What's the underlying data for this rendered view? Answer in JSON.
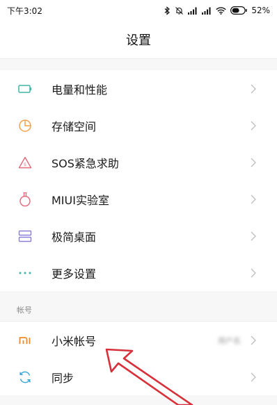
{
  "statusbar": {
    "time": "下午3:02",
    "battery_percent": "52%",
    "icons": [
      "bluetooth-icon",
      "alarm-off-icon",
      "signal-icon",
      "signal-icon",
      "wifi-icon",
      "battery-icon"
    ]
  },
  "header": {
    "title": "设置"
  },
  "main_section": {
    "items": [
      {
        "label": "电量和性能",
        "icon": "battery-outline-icon",
        "color": "#3fb6a8"
      },
      {
        "label": "存储空间",
        "icon": "pie-chart-icon",
        "color": "#f0a24a"
      },
      {
        "label": "SOS紧急求助",
        "icon": "sos-warning-icon",
        "color": "#e06a7a"
      },
      {
        "label": "MIUI实验室",
        "icon": "flask-icon",
        "color": "#e06a7a"
      },
      {
        "label": "极简桌面",
        "icon": "layout-icon",
        "color": "#8a7fd6"
      },
      {
        "label": "更多设置",
        "icon": "more-dots-icon",
        "color": "#3fb6a8"
      }
    ]
  },
  "account_section": {
    "header": "帐号",
    "items": [
      {
        "label": "小米帐号",
        "icon": "mi-logo-icon",
        "color": "#f08a24",
        "value": "用户名"
      },
      {
        "label": "同步",
        "icon": "sync-icon",
        "color": "#3aa6d8"
      }
    ]
  },
  "colors": {
    "background": "#f7f7f7",
    "annotation_arrow": "#d8303a"
  }
}
